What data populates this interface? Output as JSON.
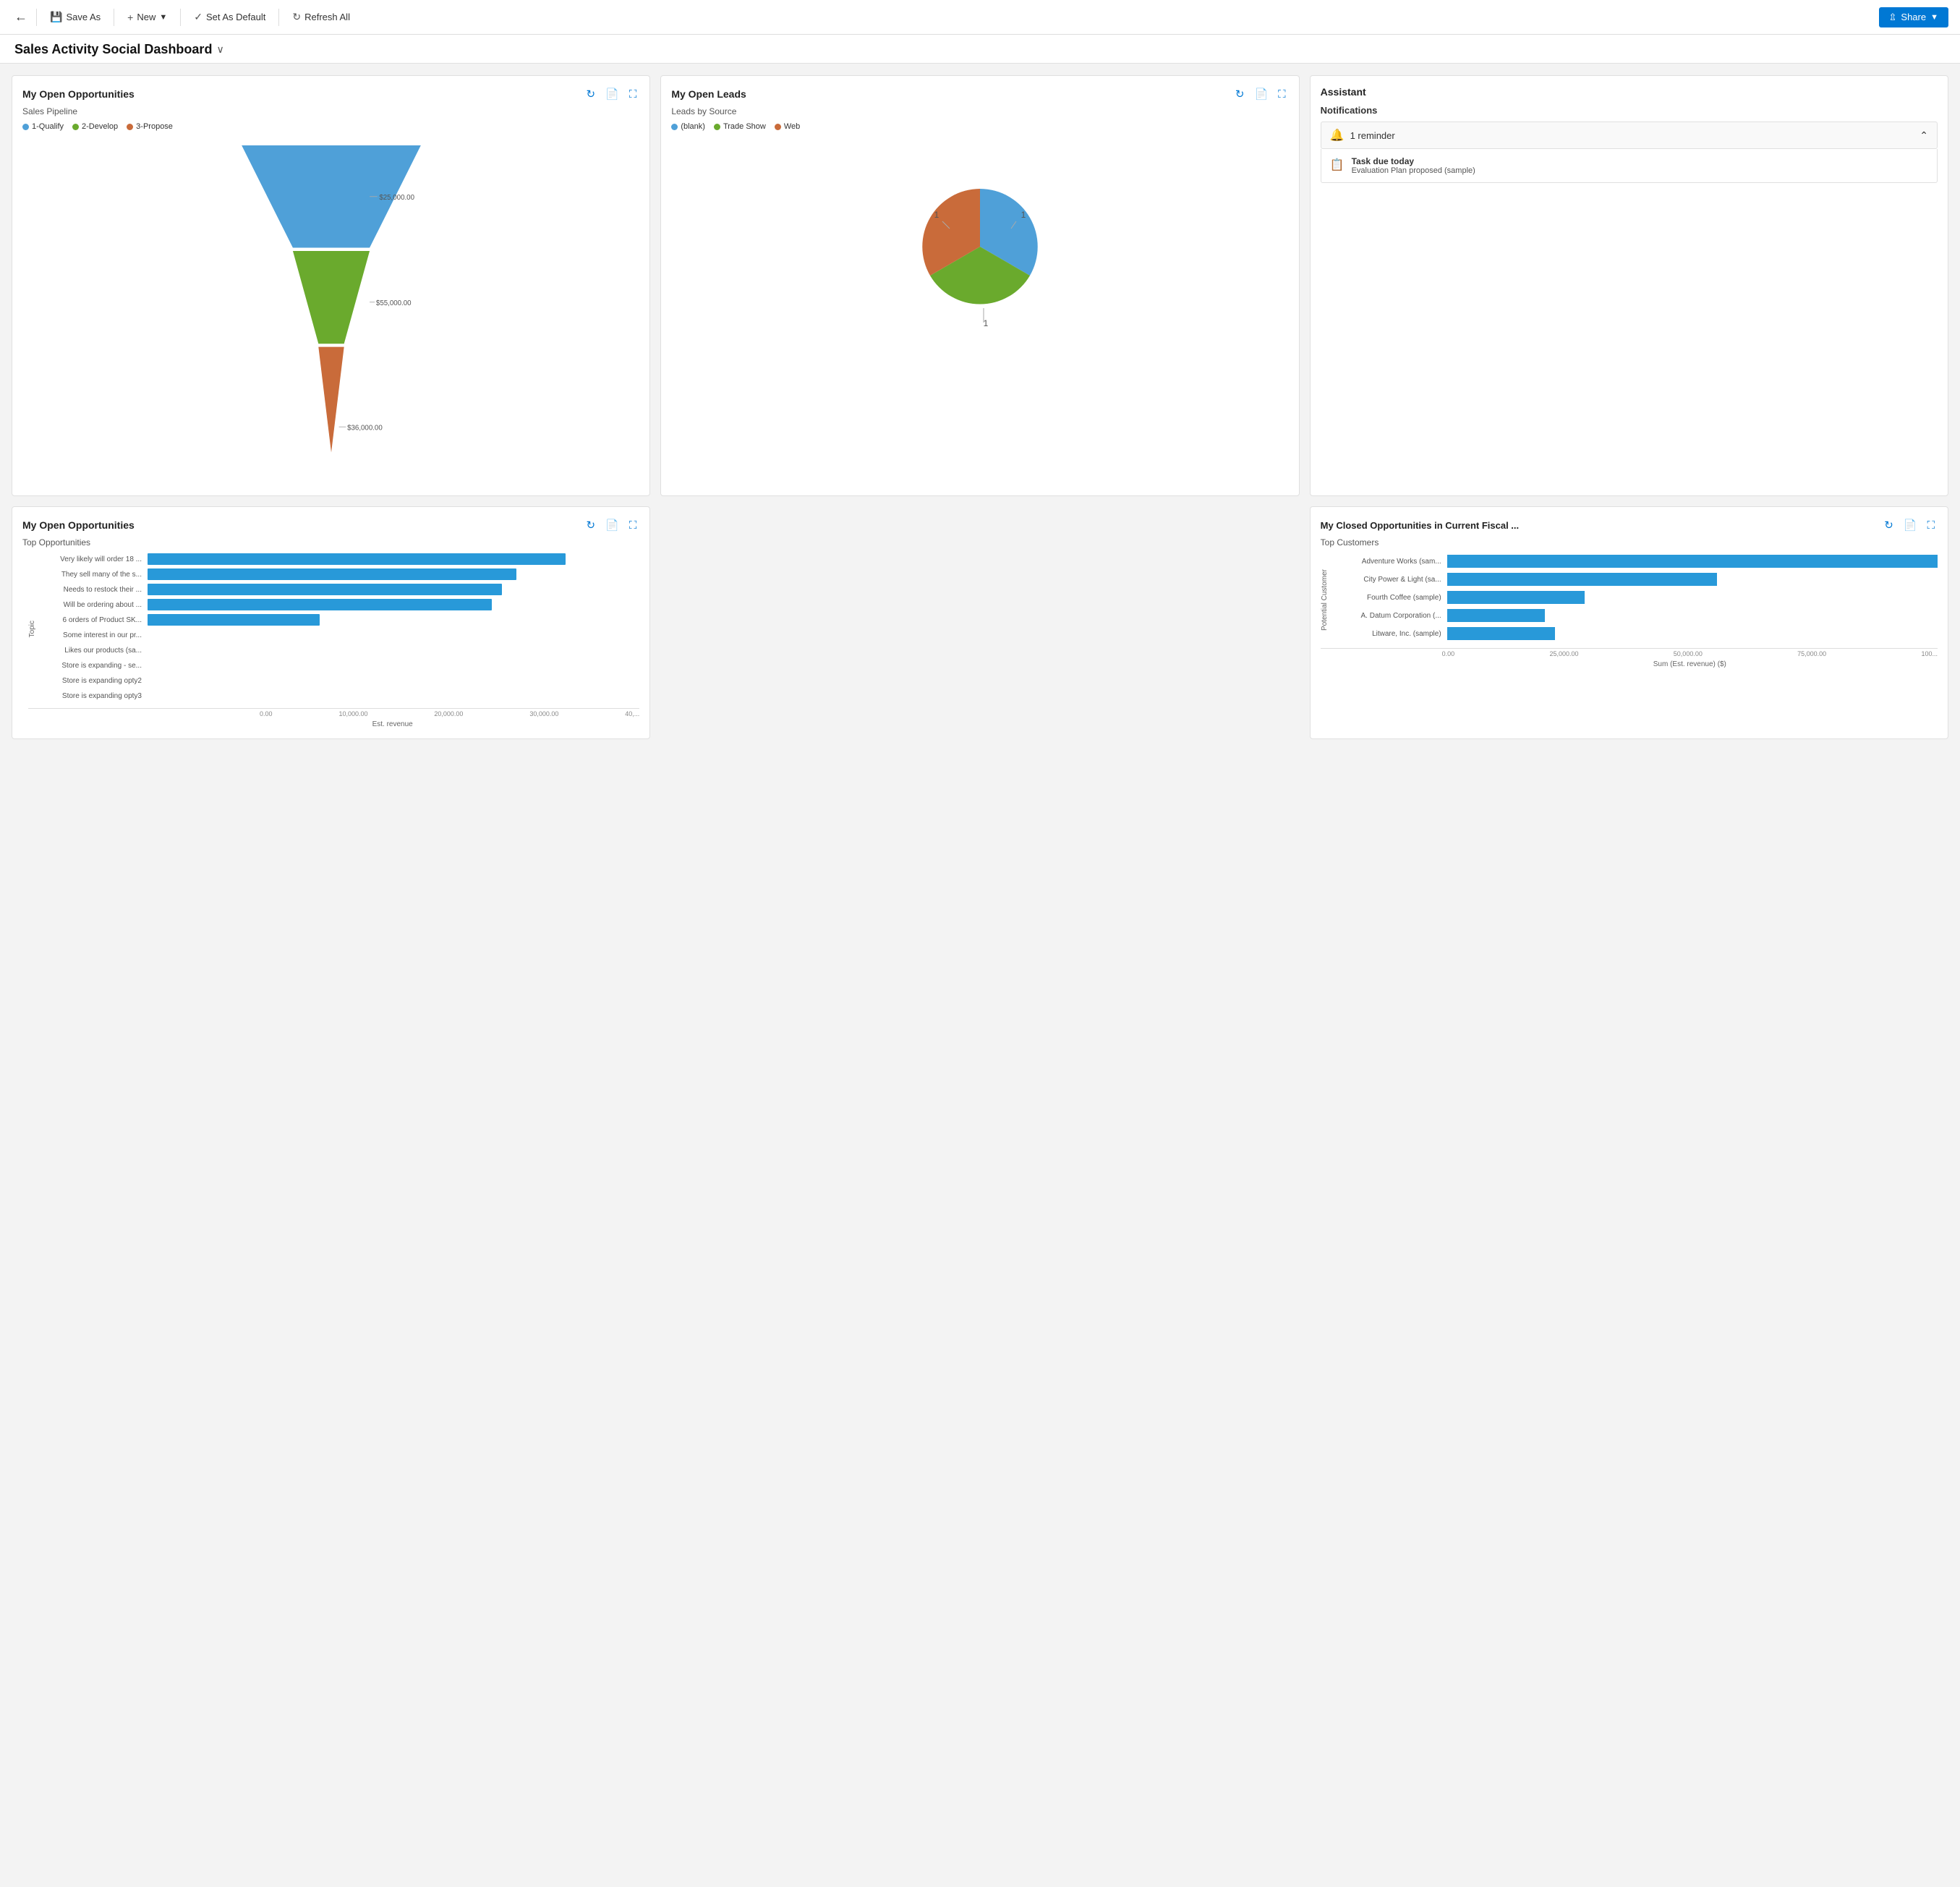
{
  "toolbar": {
    "back_label": "←",
    "save_as_label": "Save As",
    "new_label": "New",
    "set_default_label": "Set As Default",
    "refresh_label": "Refresh All",
    "share_label": "Share"
  },
  "dashboard": {
    "title": "Sales Activity Social Dashboard",
    "caret": "∨"
  },
  "opportunities_card": {
    "title": "My Open Opportunities",
    "subtitle": "Sales Pipeline",
    "legend": [
      {
        "label": "1-Qualify",
        "color": "#4fa0d8"
      },
      {
        "label": "2-Develop",
        "color": "#6aaa2d"
      },
      {
        "label": "3-Propose",
        "color": "#c96b3a"
      }
    ],
    "funnel": [
      {
        "label": "1-Qualify",
        "value": "$25,000.00",
        "color": "#4fa0d8",
        "pct": 100
      },
      {
        "label": "2-Develop",
        "value": "$55,000.00",
        "color": "#6aaa2d",
        "pct": 72
      },
      {
        "label": "3-Propose",
        "value": "$36,000.00",
        "color": "#c96b3a",
        "pct": 40
      }
    ]
  },
  "leads_card": {
    "title": "My Open Leads",
    "subtitle": "Leads by Source",
    "legend": [
      {
        "label": "(blank)",
        "color": "#4fa0d8"
      },
      {
        "label": "Trade Show",
        "color": "#6aaa2d"
      },
      {
        "label": "Web",
        "color": "#c96b3a"
      }
    ],
    "pie": [
      {
        "label": "(blank)",
        "value": 1,
        "color": "#4fa0d8",
        "startAngle": 0,
        "endAngle": 120
      },
      {
        "label": "Trade Show",
        "value": 1,
        "color": "#6aaa2d",
        "startAngle": 120,
        "endAngle": 240
      },
      {
        "label": "Web",
        "value": 1,
        "color": "#c96b3a",
        "startAngle": 240,
        "endAngle": 360
      }
    ]
  },
  "assistant_card": {
    "title": "Assistant",
    "notifications_label": "Notifications",
    "reminder_count": "1 reminder",
    "task_title": "Task due today",
    "task_sub": "Evaluation Plan proposed (sample)"
  },
  "open_opps_card": {
    "title": "My Open Opportunities",
    "subtitle": "Top Opportunities",
    "x_label": "Est. revenue",
    "bars": [
      {
        "label": "Very likely will order 18 ...",
        "value": 85
      },
      {
        "label": "They sell many of the s...",
        "value": 75
      },
      {
        "label": "Needs to restock their ...",
        "value": 72
      },
      {
        "label": "Will be ordering about ...",
        "value": 70
      },
      {
        "label": "6 orders of Product SK...",
        "value": 35
      },
      {
        "label": "Some interest in our pr...",
        "value": 0
      },
      {
        "label": "Likes our products (sa...",
        "value": 0
      },
      {
        "label": "Store is expanding - se...",
        "value": 0
      },
      {
        "label": "Store is expanding opty2",
        "value": 0
      },
      {
        "label": "Store is expanding opty3",
        "value": 0
      }
    ],
    "x_ticks": [
      "0.00",
      "10,000.00",
      "20,000.00",
      "30,000.00",
      "40,..."
    ],
    "y_label": "Topic"
  },
  "closed_opps_card": {
    "title": "My Closed Opportunities in Current Fiscal ...",
    "subtitle": "Top Customers",
    "x_label": "Sum (Est. revenue) ($)",
    "y_label": "Potential Customer",
    "bars": [
      {
        "label": "Adventure Works (sam...",
        "value": 100
      },
      {
        "label": "City Power & Light (sa...",
        "value": 55
      },
      {
        "label": "Fourth Coffee (sample)",
        "value": 28
      },
      {
        "label": "A. Datum Corporation (...",
        "value": 20
      },
      {
        "label": "Litware, Inc. (sample)",
        "value": 22
      }
    ],
    "x_ticks": [
      "0.00",
      "25,000.00",
      "50,000.00",
      "75,000.00",
      "100..."
    ]
  }
}
